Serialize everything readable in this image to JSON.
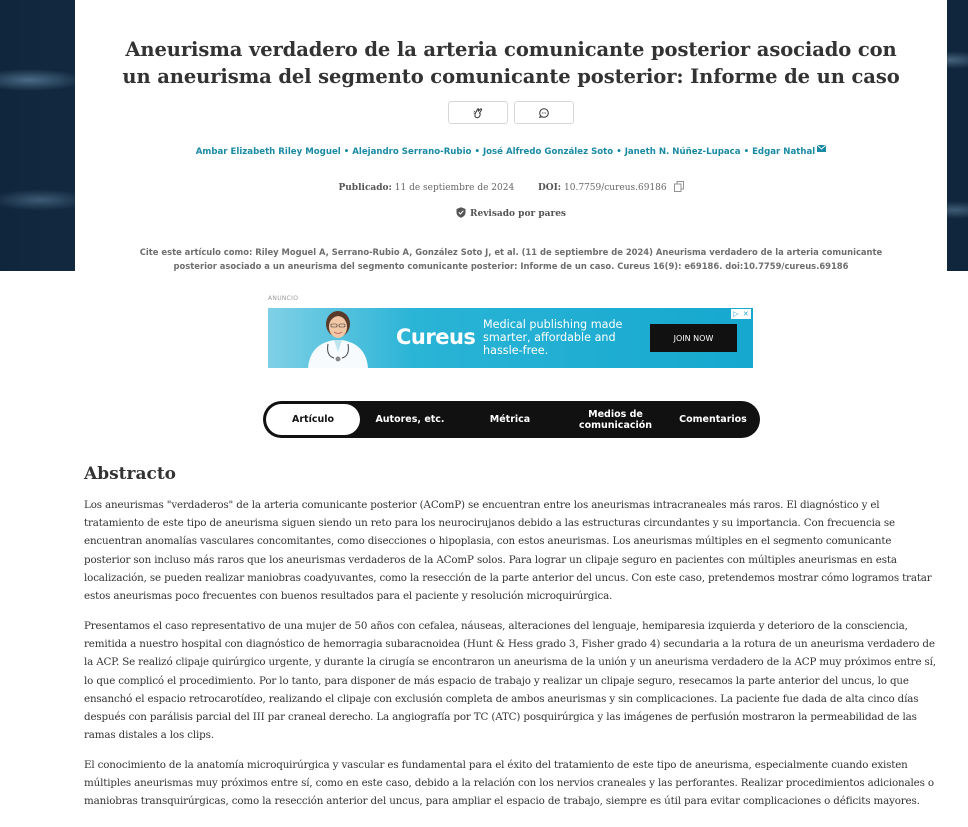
{
  "article": {
    "title": "Aneurisma verdadero de la arteria comunicante posterior asociado con un aneurisma del segmento comunicante posterior: Informe de un caso",
    "actions": [
      {
        "icon": "clap-icon"
      },
      {
        "icon": "comment-icon"
      }
    ],
    "authors": [
      "Ambar Elizabeth Riley Moguel",
      "Alejandro Serrano-Rubio",
      "José Alfredo González Soto",
      "Janeth N. Núñez-Lupaca",
      "Edgar Nathal"
    ],
    "author_separator": "•",
    "published_label": "Publicado:",
    "published_date": "11 de septiembre de 2024",
    "doi_label": "DOI:",
    "doi_value": "10.7759/cureus.69186",
    "peer_reviewed": "Revisado por pares",
    "cite_text": "Cite este artículo como: Riley Moguel A, Serrano-Rubio A, González Soto J, et al. (11 de septiembre de 2024) Aneurisma verdadero de la arteria comunicante posterior asociado a un aneurisma del segmento comunicante posterior: Informe de un caso. Cureus 16(9): e69186. doi:10.7759/cureus.69186"
  },
  "ad": {
    "label": "ANUNCIO",
    "logo": "Cureus",
    "text": "Medical publishing made smarter, affordable and hassle-free.",
    "button": "JOIN NOW"
  },
  "tabs": [
    {
      "label": "Artículo",
      "active": true
    },
    {
      "label": "Autores, etc.",
      "active": false
    },
    {
      "label": "Métrica",
      "active": false
    },
    {
      "label": "Medios de comunicación",
      "active": false
    },
    {
      "label": "Comentarios",
      "active": false
    }
  ],
  "abstract": {
    "heading": "Abstracto",
    "paragraphs": [
      "Los aneurismas \"verdaderos\" de la arteria comunicante posterior (AComP) se encuentran entre los aneurismas intracraneales más raros. El diagnóstico y el tratamiento de este tipo de aneurisma siguen siendo un reto para los neurocirujanos debido a las estructuras circundantes y su importancia. Con frecuencia se encuentran anomalías vasculares concomitantes, como disecciones o hipoplasia, con estos aneurismas. Los aneurismas múltiples en el segmento comunicante posterior son incluso más raros que los aneurismas verdaderos de la AComP solos. Para lograr un clipaje seguro en pacientes con múltiples aneurismas en esta localización, se pueden realizar maniobras coadyuvantes, como la resección de la parte anterior del uncus. Con este caso, pretendemos mostrar cómo logramos tratar estos aneurismas poco frecuentes con buenos resultados para el paciente y resolución microquirúrgica.",
      "Presentamos el caso representativo de una mujer de 50 años con cefalea, náuseas, alteraciones del lenguaje, hemiparesia izquierda y deterioro de la consciencia, remitida a nuestro hospital con diagnóstico de hemorragia subaracnoidea (Hunt & Hess grado 3, Fisher grado 4) secundaria a la rotura de un aneurisma verdadero de la ACP. Se realizó clipaje quirúrgico urgente, y durante la cirugía se encontraron un aneurisma de la unión y un aneurisma verdadero de la ACP muy próximos entre sí, lo que complicó el procedimiento. Por lo tanto, para disponer de más espacio de trabajo y realizar un clipaje seguro, resecamos la parte anterior del uncus, lo que ensanchó el espacio retrocarotídeo, realizando el clipaje con exclusión completa de ambos aneurismas y sin complicaciones. La paciente fue dada de alta cinco días después con parálisis parcial del III par craneal derecho. La angiografía por TC (ATC) posquirúrgica y las imágenes de perfusión mostraron la permeabilidad de las ramas distales a los clips.",
      "El conocimiento de la anatomía microquirúrgica y vascular es fundamental para el éxito del tratamiento de este tipo de aneurisma, especialmente cuando existen múltiples aneurismas muy próximos entre sí, como en este caso, debido a la relación con los nervios craneales y las perforantes. Realizar procedimientos adicionales o maniobras transquirúrgicas, como la resección anterior del uncus, para ampliar el espacio de trabajo, siempre es útil para evitar complicaciones o déficits mayores."
    ]
  }
}
